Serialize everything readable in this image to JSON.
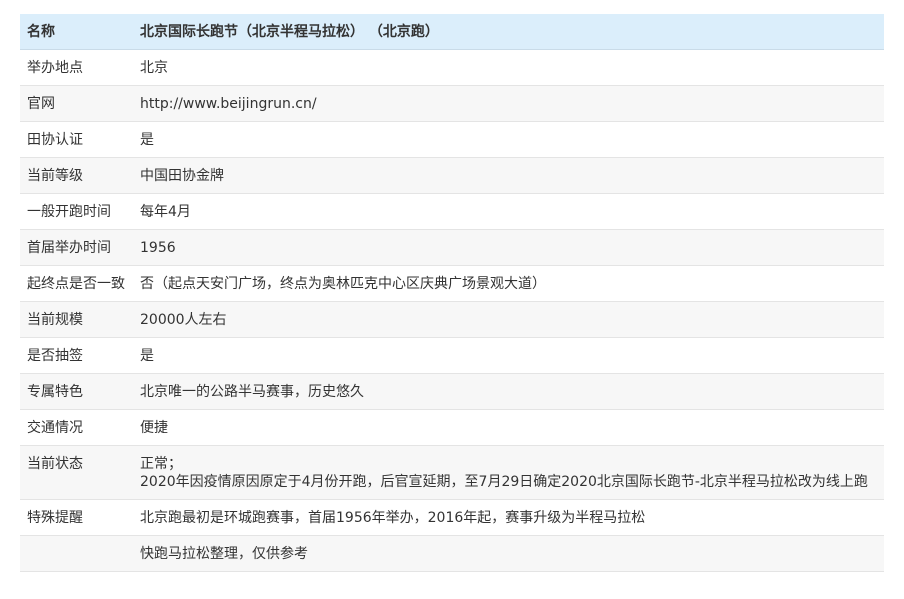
{
  "table": {
    "header": {
      "label": "名称",
      "value": "北京国际长跑节（北京半程马拉松） （北京跑）"
    },
    "rows": [
      {
        "label": "举办地点",
        "lines": [
          "北京"
        ]
      },
      {
        "label": "官网",
        "lines": [
          "http://www.beijingrun.cn/"
        ]
      },
      {
        "label": "田协认证",
        "lines": [
          "是"
        ]
      },
      {
        "label": "当前等级",
        "lines": [
          "中国田协金牌"
        ]
      },
      {
        "label": "一般开跑时间",
        "lines": [
          "每年4月"
        ]
      },
      {
        "label": "首届举办时间",
        "lines": [
          "1956"
        ]
      },
      {
        "label": "起终点是否一致",
        "lines": [
          "否（起点天安门广场，终点为奥林匹克中心区庆典广场景观大道）"
        ]
      },
      {
        "label": "当前规模",
        "lines": [
          "20000人左右"
        ]
      },
      {
        "label": "是否抽签",
        "lines": [
          "是"
        ]
      },
      {
        "label": "专属特色",
        "lines": [
          "北京唯一的公路半马赛事，历史悠久"
        ]
      },
      {
        "label": "交通情况",
        "lines": [
          "便捷"
        ]
      },
      {
        "label": "当前状态",
        "lines": [
          "正常；",
          "2020年因疫情原因原定于4月份开跑，后官宣延期，至7月29日确定2020北京国际长跑节-北京半程马拉松改为线上跑"
        ]
      },
      {
        "label": "特殊提醒",
        "lines": [
          "北京跑最初是环城跑赛事，首届1956年举办，2016年起，赛事升级为半程马拉松"
        ]
      },
      {
        "label": "",
        "lines": [
          "快跑马拉松整理，仅供参考"
        ]
      }
    ]
  }
}
